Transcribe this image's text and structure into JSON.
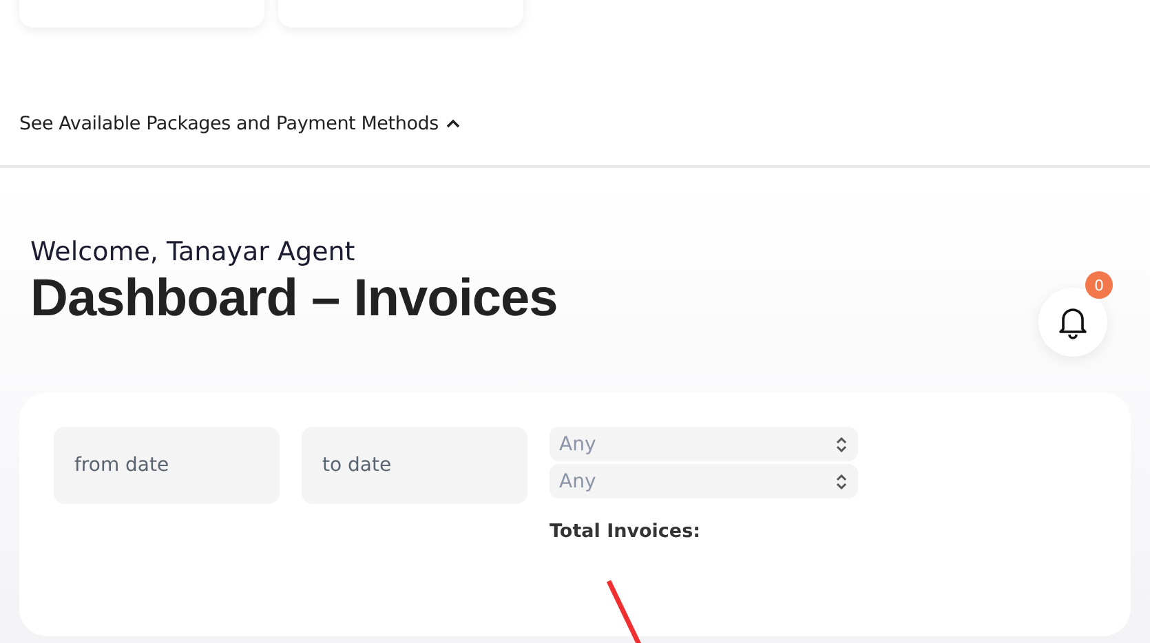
{
  "packages_link": {
    "label": "See Available Packages and Payment Methods",
    "expanded": true
  },
  "header": {
    "greeting": "Welcome, Tanayar Agent",
    "title": "Dashboard – Invoices",
    "notifications": {
      "count": "0"
    }
  },
  "filters": {
    "from_date": {
      "placeholder": "from date"
    },
    "to_date": {
      "placeholder": "to date"
    },
    "selects": [
      {
        "value": "Any"
      },
      {
        "value": "Any"
      }
    ],
    "total_label": "Total Invoices:"
  }
}
